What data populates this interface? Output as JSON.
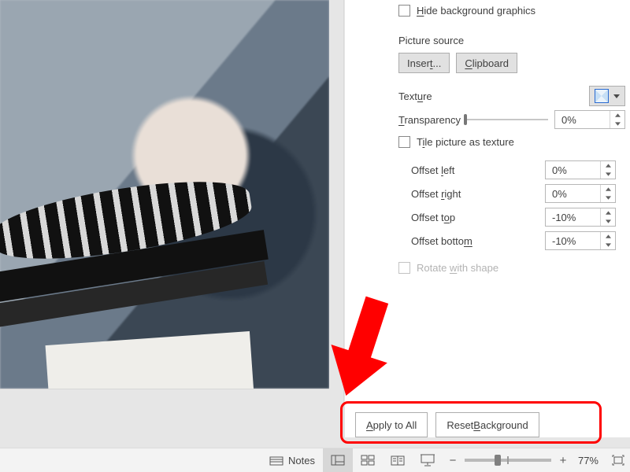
{
  "panel": {
    "hide_bg": "Hide background graphics",
    "picture_source_title": "Picture source",
    "insert_btn": "Insert...",
    "clipboard_btn": "Clipboard",
    "texture_label": "Texture",
    "transparency_label": "Transparency",
    "transparency_value": "0%",
    "tile_label": "Tile picture as texture",
    "offsets": [
      {
        "label": "Offset left",
        "value": "0%"
      },
      {
        "label": "Offset right",
        "value": "0%"
      },
      {
        "label": "Offset top",
        "value": "-10%"
      },
      {
        "label": "Offset bottom",
        "value": "-10%"
      }
    ],
    "rotate_label": "Rotate with shape"
  },
  "footer": {
    "apply_all": "Apply to All",
    "reset_bg": "Reset Background"
  },
  "status": {
    "notes": "Notes",
    "zoom_pct": "77%"
  }
}
